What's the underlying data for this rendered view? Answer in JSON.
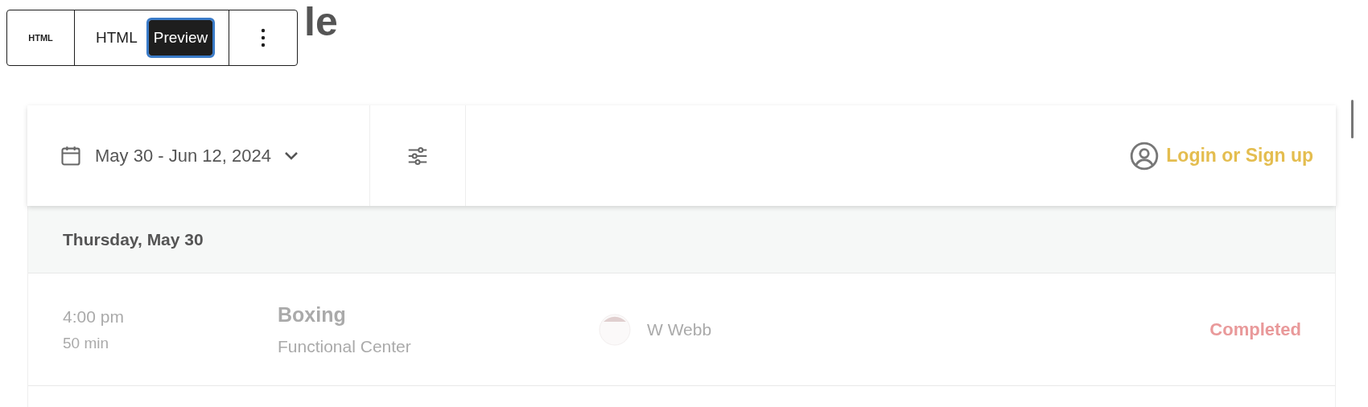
{
  "page_title": "le",
  "block_toolbar": {
    "block_label": "HTML",
    "tabs": [
      {
        "label": "HTML",
        "selected": false
      },
      {
        "label": "Preview",
        "selected": true
      }
    ]
  },
  "schedule": {
    "date_range": "May 30 - Jun 12, 2024",
    "login": "Login or Sign up",
    "days": [
      {
        "heading": "Thursday, May 30",
        "classes": [
          {
            "time": "4:00 pm",
            "duration": "50 min",
            "name": "Boxing",
            "location": "Functional Center",
            "instructor": "W Webb",
            "status": "Completed"
          }
        ]
      }
    ]
  }
}
